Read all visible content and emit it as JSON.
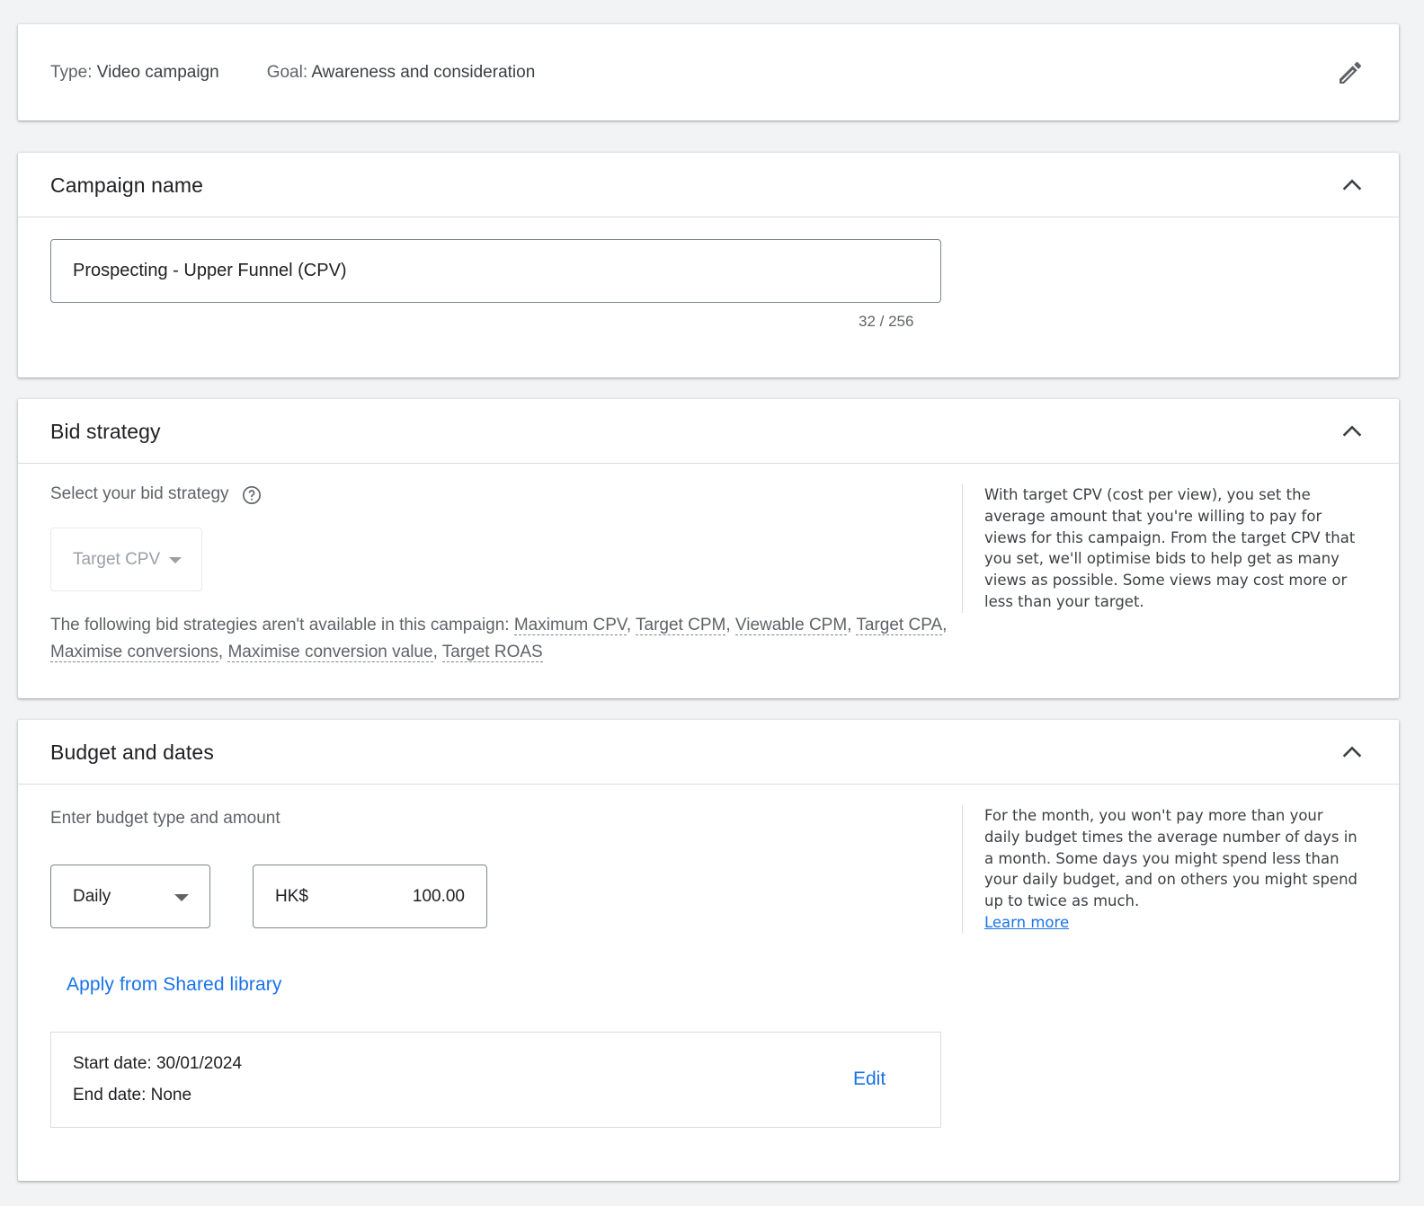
{
  "summary": {
    "type_label": "Type:",
    "type_value": "Video campaign",
    "goal_label": "Goal:",
    "goal_value": "Awareness and consideration",
    "edit_icon": "pencil-icon"
  },
  "campaign_name": {
    "title": "Campaign name",
    "value": "Prospecting - Upper Funnel (CPV)",
    "char_count": "32 / 256",
    "collapse_icon": "chevron-up-icon"
  },
  "bid_strategy": {
    "title": "Bid strategy",
    "select_label": "Select your bid strategy",
    "help_icon": "help-circle-icon",
    "selected": "Target CPV",
    "unavailable_prefix": "The following bid strategies aren't available in this campaign: ",
    "unavailable": [
      "Maximum CPV",
      "Target CPM",
      "Viewable CPM",
      "Target CPA",
      "Maximise conversions",
      "Maximise conversion value",
      "Target ROAS"
    ],
    "side_text": "With target CPV (cost per view), you set the average amount that you're willing to pay for views for this campaign. From the target CPV that you set, we'll optimise bids to help get as many views as possible. Some views may cost more or less than your target."
  },
  "budget": {
    "title": "Budget and dates",
    "enter_label": "Enter budget type and amount",
    "type_selected": "Daily",
    "currency": "HK$",
    "amount": "100.00",
    "shared_library": "Apply from Shared library",
    "start_date": "Start date: 30/01/2024",
    "end_date": "End date: None",
    "edit_label": "Edit",
    "side_text": "For the month, you won't pay more than your daily budget times the average number of days in a month. Some days you might spend less than your daily budget, and on others you might spend up to twice as much.",
    "learn_more": "Learn more"
  },
  "colors": {
    "background": "#f1f3f4",
    "link": "#1a73e8",
    "text": "#3c4043"
  }
}
